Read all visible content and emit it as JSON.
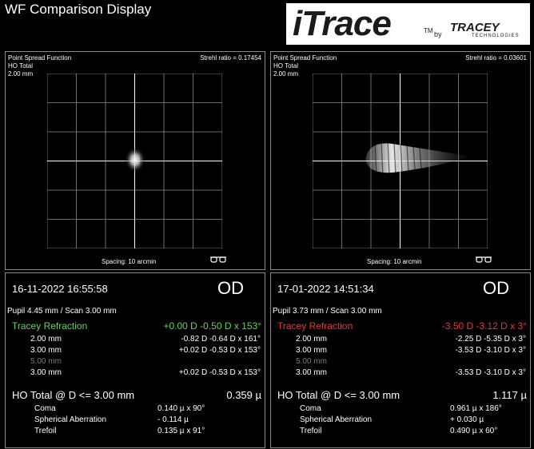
{
  "app": {
    "title": "WF Comparison Display"
  },
  "logo": {
    "brand": "iTrace",
    "tm": "TM",
    "by": "by",
    "company": "TRACEY",
    "company_sub": "TECHNOLOGIES"
  },
  "psf_left": {
    "line1": "Point Spread Function",
    "line2": "HO Total",
    "line3": "2.00 mm",
    "strehl": "Strehl ratio = 0.17454",
    "spacing": "Spacing:  10 arcmin"
  },
  "psf_right": {
    "line1": "Point Spread Function",
    "line2": "HO Total",
    "line3": "2.00 mm",
    "strehl": "Strehl ratio = 0.03601",
    "spacing": "Spacing:  10 arcmin"
  },
  "exam_left": {
    "datetime": "16-11-2022  16:55:58",
    "eye": "OD",
    "pupil": "Pupil 4.45 mm  /  Scan 3.00 mm",
    "refraction_title": "Tracey Refraction",
    "refraction_value": "+0.00 D -0.50 D x 153°",
    "refraction_color": "#5fd35f",
    "rows": [
      {
        "label": "2.00 mm",
        "value": "-0.82 D -0.64 D x 161°"
      },
      {
        "label": "3.00 mm",
        "value": "+0.02 D -0.53 D x 153°"
      },
      {
        "label": "5.00 mm",
        "value": ""
      },
      {
        "label": "3.00 mm",
        "value": "+0.02 D -0.53 D x 153°"
      }
    ],
    "ho_title": "HO Total @ D <= 3.00 mm",
    "ho_value": "0.359 µ",
    "aberrations": [
      {
        "label": "Coma",
        "value": "0.140 µ x   90°"
      },
      {
        "label": "Spherical Aberration",
        "value": "- 0.114 µ"
      },
      {
        "label": "Trefoil",
        "value": "0.135 µ x   91°"
      }
    ]
  },
  "exam_right": {
    "datetime": "17-01-2022  14:51:34",
    "eye": "OD",
    "pupil": "Pupil 3.73 mm  /  Scan 3.00 mm",
    "refraction_title": "Tracey Refraction",
    "refraction_value": "-3.50 D -3.12 D x 3°",
    "refraction_color": "#e03a3a",
    "rows": [
      {
        "label": "2.00 mm",
        "value": "-2.25 D -5.35 D x 3°"
      },
      {
        "label": "3.00 mm",
        "value": "-3.53 D -3.10 D x 3°"
      },
      {
        "label": "5.00 mm",
        "value": ""
      },
      {
        "label": "3.00 mm",
        "value": "-3.53 D -3.10 D x 3°"
      }
    ],
    "ho_title": "HO Total @ D <= 3.00 mm",
    "ho_value": "1.117 µ",
    "aberrations": [
      {
        "label": "Coma",
        "value": "0.961 µ x 186°"
      },
      {
        "label": "Spherical Aberration",
        "value": "+ 0.030 µ"
      },
      {
        "label": "Trefoil",
        "value": "0.490 µ x   60°"
      }
    ]
  }
}
